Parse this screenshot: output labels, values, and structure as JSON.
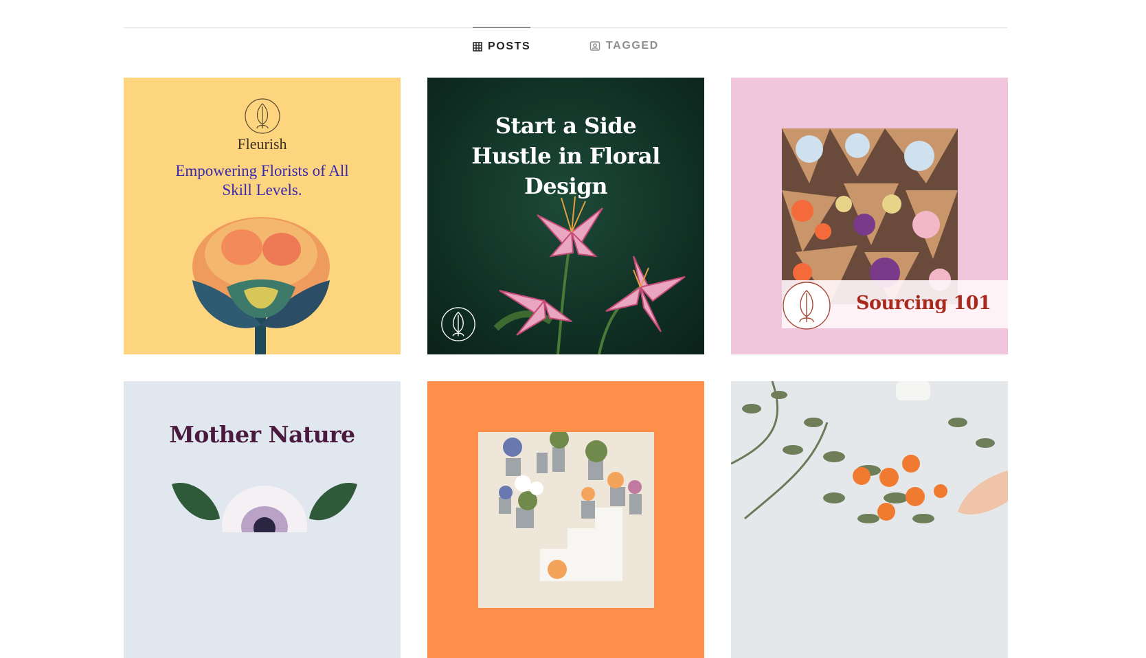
{
  "tabs": [
    {
      "label": "POSTS",
      "icon": "grid-icon",
      "active": true
    },
    {
      "label": "TAGGED",
      "icon": "tagged-user-icon",
      "active": false
    }
  ],
  "posts": [
    {
      "brand": "Fleurish",
      "headline": "Empowering Florists of All Skill Levels.",
      "background": "#fdd57e",
      "icon": "fleurish-logo-icon"
    },
    {
      "headline": "Start a Side Hustle in Floral Design",
      "background": "#123a2b",
      "icon": "fleurish-logo-icon"
    },
    {
      "headline": "Sourcing 101",
      "background": "#f0c6dd",
      "icon": "fleurish-logo-icon"
    },
    {
      "headline": "Mother Nature",
      "background": "#e0e7ee"
    },
    {
      "headline": "",
      "background": "#fe8f4a"
    },
    {
      "headline": "",
      "background": "#e4e8ea"
    }
  ]
}
